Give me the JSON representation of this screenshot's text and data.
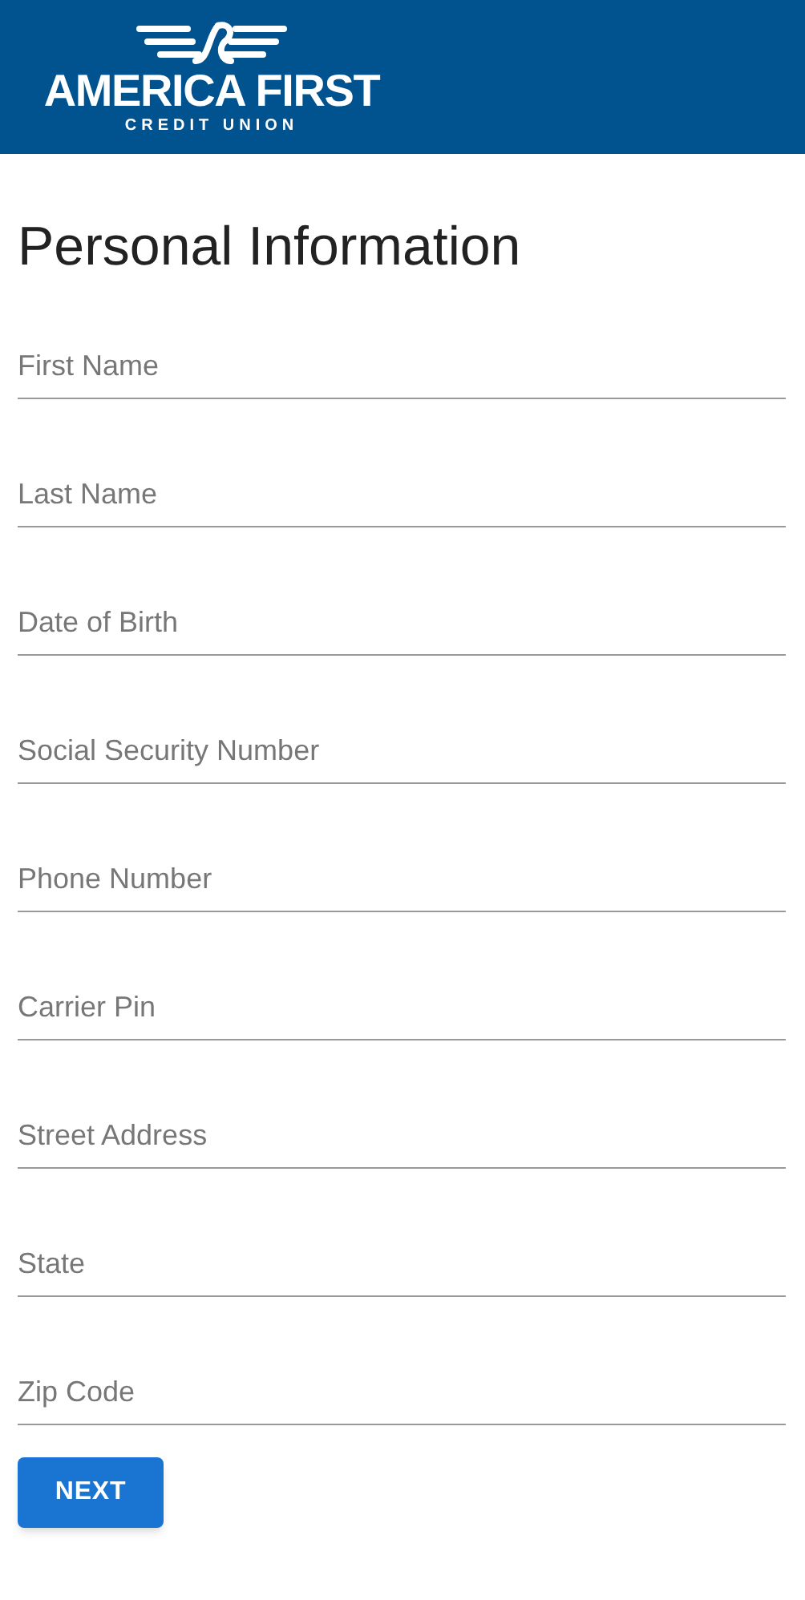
{
  "header": {
    "logo_title": "AMERICA FIRST",
    "logo_subtitle": "CREDIT UNION"
  },
  "title": "Personal Information",
  "fields": [
    {
      "placeholder": "First Name"
    },
    {
      "placeholder": "Last Name"
    },
    {
      "placeholder": "Date of Birth"
    },
    {
      "placeholder": "Social Security Number"
    },
    {
      "placeholder": "Phone Number"
    },
    {
      "placeholder": "Carrier Pin"
    },
    {
      "placeholder": "Street Address"
    },
    {
      "placeholder": "State"
    },
    {
      "placeholder": "Zip Code"
    }
  ],
  "button": "NEXT"
}
